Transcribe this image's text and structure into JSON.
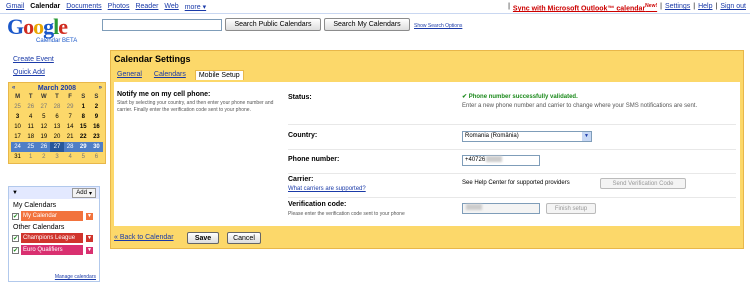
{
  "topnav": {
    "links": [
      "Gmail",
      "Calendar",
      "Documents",
      "Photos",
      "Reader",
      "Web",
      "more ▾"
    ],
    "active": "Calendar",
    "sync": "Sync with Microsoft Outlook™ calendar",
    "new_badge": "New!",
    "settings": "Settings",
    "help": "Help",
    "signout": "Sign out",
    "sep": "|"
  },
  "logo": {
    "letters": [
      "G",
      "o",
      "o",
      "g",
      "l",
      "e"
    ],
    "sub": "Calendar BETA"
  },
  "search": {
    "public_label": "Search Public Calendars",
    "mine_label": "Search My Calendars",
    "options_label": "Show Search Options"
  },
  "sidebar": {
    "create_event": "Create Event",
    "quick_add": "Quick Add"
  },
  "minical": {
    "prev": "«",
    "next": "»",
    "month": "March 2008",
    "dow": [
      "M",
      "T",
      "W",
      "T",
      "F",
      "S",
      "S"
    ],
    "weeks": [
      [
        "25",
        "26",
        "27",
        "28",
        "29",
        "1",
        "2"
      ],
      [
        "3",
        "4",
        "5",
        "6",
        "7",
        "8",
        "9"
      ],
      [
        "10",
        "11",
        "12",
        "13",
        "14",
        "15",
        "16"
      ],
      [
        "17",
        "18",
        "19",
        "20",
        "21",
        "22",
        "23"
      ],
      [
        "24",
        "25",
        "26",
        "27",
        "28",
        "29",
        "30"
      ],
      [
        "31",
        "1",
        "2",
        "3",
        "4",
        "5",
        "6"
      ]
    ]
  },
  "calendars": {
    "add_label": "Add",
    "my_title": "My Calendars",
    "other_title": "Other Calendars",
    "my": [
      {
        "name": "My Calendar",
        "color": "#f2733d"
      }
    ],
    "other": [
      {
        "name": "Champions League",
        "color": "#d0342c"
      },
      {
        "name": "Euro Qualifiers",
        "color": "#d93070"
      }
    ],
    "manage": "Manage calendars"
  },
  "settings": {
    "title": "Calendar Settings",
    "tabs": [
      "General",
      "Calendars",
      "Mobile Setup"
    ],
    "active_tab": "Mobile Setup",
    "intro_heading": "Notify me on my cell phone:",
    "intro_text": "Start by selecting your country, and then enter your phone number and carrier. Finally enter the verification code sent to your phone.",
    "status_label": "Status:",
    "status_value": "Phone number successfully validated.",
    "status_check": "✔",
    "status_hint": "Enter a new phone number and carrier to change where your SMS notifications are sent.",
    "country_label": "Country:",
    "country_value": "Romania (România)",
    "phone_label": "Phone number:",
    "phone_value": "+40726",
    "carrier_label": "Carrier:",
    "carrier_link": "What carriers are supported?",
    "carrier_value": "See Help Center for supported providers",
    "send_code": "Send Verification Code",
    "verify_label": "Verification code:",
    "verify_hint": "Please enter the verification code sent to your phone",
    "finish": "Finish setup",
    "back": "« Back to Calendar",
    "save": "Save",
    "cancel": "Cancel"
  }
}
